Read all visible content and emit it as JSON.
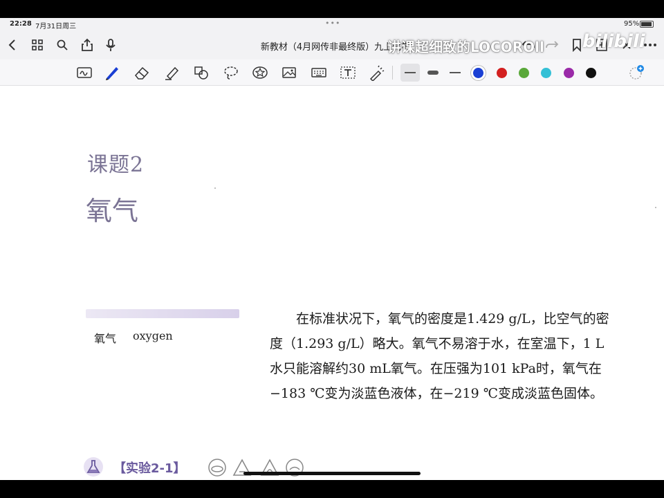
{
  "status_bar": {
    "time": "22:28",
    "date": "7月31日周三",
    "battery": "95%"
  },
  "title_bar": {
    "document_title": "新教材（4月网传非最终版）九上化学",
    "dropdown_icon": "chevron-down-icon"
  },
  "watermark": {
    "text": "讲课超细致的LOCOROll",
    "logo": "bilibili"
  },
  "toolbar": {
    "tools": [
      "handwriting-icon",
      "pen-icon",
      "eraser-icon",
      "highlighter-icon",
      "shapes-icon",
      "lasso-icon",
      "sticker-icon",
      "image-icon",
      "keyboard-icon",
      "text-icon",
      "laser-pointer-icon"
    ],
    "colors": [
      "#1a3fd4",
      "#d32020",
      "#5aa83a",
      "#34c0d6",
      "#9a2aa8",
      "#111111"
    ]
  },
  "page": {
    "lesson_number": "课题2",
    "lesson_title": "氧气",
    "glossary": {
      "chinese": "氧气",
      "english": "oxygen"
    },
    "body": "在标准状况下，氧气的密度是1.429 g/L，比空气的密度（1.293 g/L）略大。氧气不易溶于水，在室温下，1 L水只能溶解约30 mL氧气。在压强为101 kPa时，氧气在−183 ℃变为淡蓝色液体，在−219 ℃变成淡蓝色固体。",
    "experiment_label": "【实验2-1】"
  }
}
